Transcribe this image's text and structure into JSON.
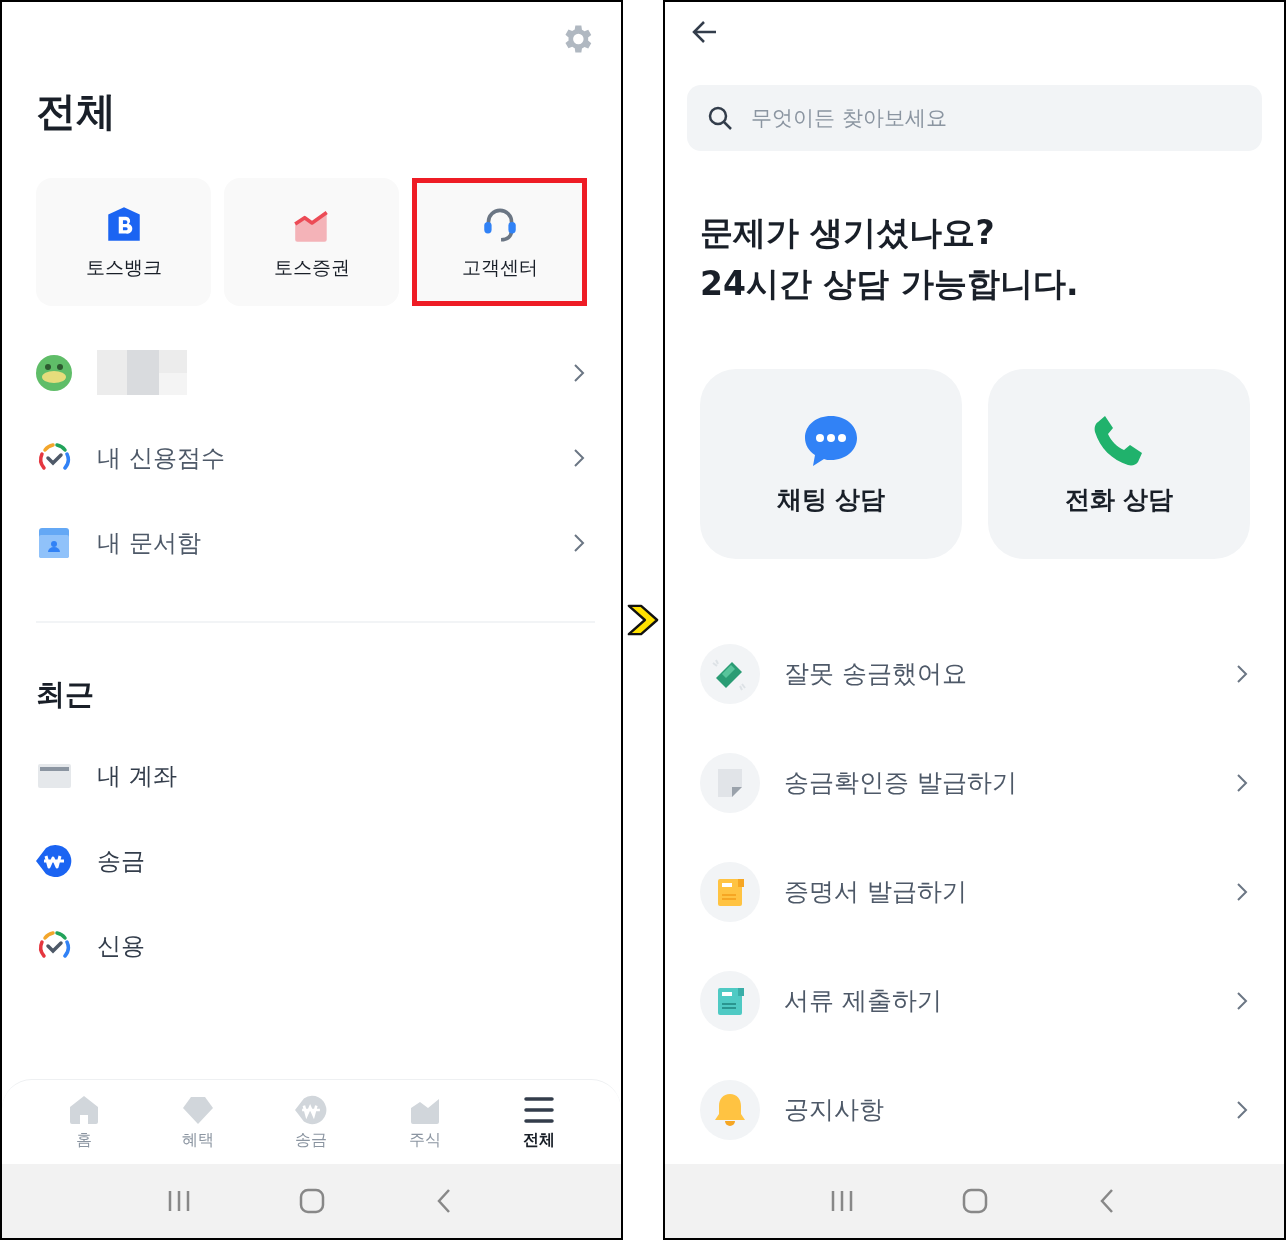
{
  "left_screen": {
    "title": "전체",
    "shortcuts": [
      {
        "label": "토스뱅크",
        "highlighted": false
      },
      {
        "label": "토스증권",
        "highlighted": false
      },
      {
        "label": "고객센터",
        "highlighted": true
      }
    ],
    "menu_items": [
      {
        "label": "내 신용점수"
      },
      {
        "label": "내 문서함"
      }
    ],
    "recent": {
      "title": "최근",
      "items": [
        {
          "label": "내 계좌"
        },
        {
          "label": "송금"
        },
        {
          "label": "신용"
        }
      ]
    },
    "bottom_nav": [
      {
        "label": "홈",
        "selected": false
      },
      {
        "label": "혜택",
        "selected": false
      },
      {
        "label": "송금",
        "selected": false
      },
      {
        "label": "주식",
        "selected": false
      },
      {
        "label": "전체",
        "selected": true
      }
    ]
  },
  "right_screen": {
    "search": {
      "placeholder": "무엇이든 찾아보세요"
    },
    "heading": [
      "문제가 생기셨나요?",
      "24시간 상담 가능합니다."
    ],
    "consult_buttons": [
      {
        "label": "채팅 상담"
      },
      {
        "label": "전화 상담"
      }
    ],
    "help_items": [
      {
        "label": "잘못 송금했어요"
      },
      {
        "label": "송금확인증 발급하기"
      },
      {
        "label": "증명서 발급하기"
      },
      {
        "label": "서류 제출하기"
      },
      {
        "label": "공지사항"
      }
    ]
  }
}
